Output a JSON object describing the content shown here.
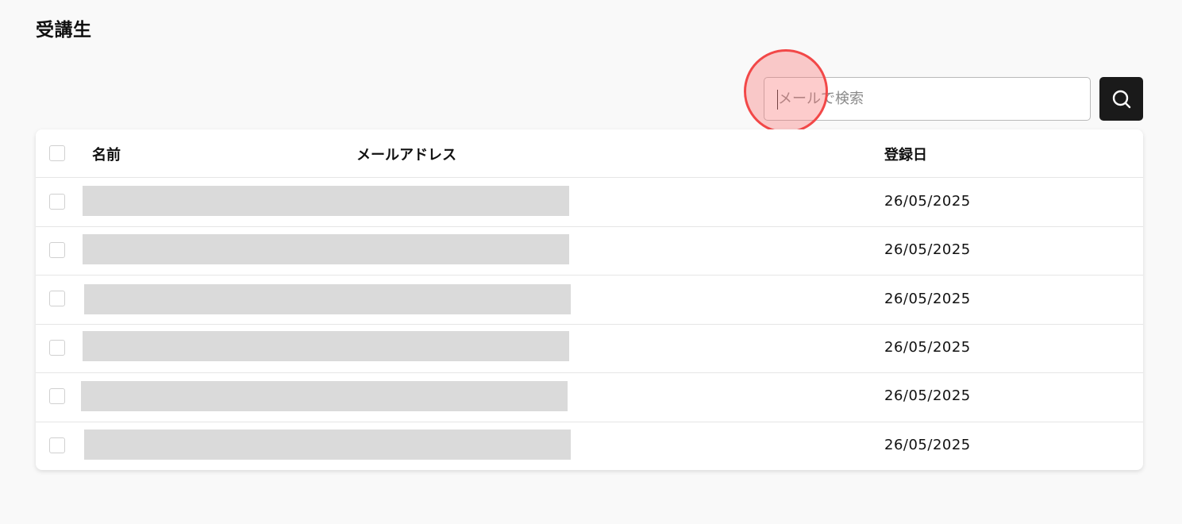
{
  "page": {
    "title": "受講生"
  },
  "search": {
    "placeholder": "メールで検索",
    "value": "",
    "button_icon": "search-icon"
  },
  "table": {
    "columns": {
      "name": "名前",
      "email": "メールアドレス",
      "registered": "登録日"
    },
    "rows": [
      {
        "date": "26/05/2025"
      },
      {
        "date": "26/05/2025"
      },
      {
        "date": "26/05/2025"
      },
      {
        "date": "26/05/2025"
      },
      {
        "date": "26/05/2025"
      },
      {
        "date": "26/05/2025"
      }
    ]
  },
  "colors": {
    "background": "#f9f9f9",
    "button": "#1a1a1a",
    "redaction": "#dadada",
    "click_marker": "#f24848"
  }
}
